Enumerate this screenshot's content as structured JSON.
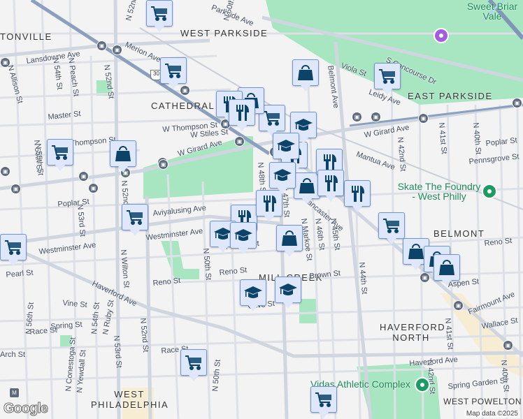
{
  "colors": {
    "marker_fill": "#dfe8fb",
    "marker_border": "#6e95d8",
    "icon": "#0b4468",
    "park": "#a8e6c1",
    "poi_text": "#1e8a5a",
    "monument": "#a35ee0"
  },
  "neighborhoods": [
    "TONVILLE",
    "WEST PARKSIDE",
    "CATHEDRAL PARK",
    "EAST PARKSIDE",
    "BELMONT",
    "MILL CREEK",
    "HAVERFORD NORTH",
    "WEST PHILADELPHIA",
    "WEST POWELTON"
  ],
  "streets": [
    "N 52nd St",
    "N 50th St",
    "Parkside Ave",
    "S Concourse Dr",
    "Merion Ave",
    "Lansdowne Ave",
    "N Allison St",
    "N 54th St",
    "N Peach St",
    "N 52nd St",
    "Master St",
    "W Thompson St",
    "W Stiles St",
    "Thompson St",
    "N 55th St",
    "W Girard Ave",
    "W Girard Ave",
    "Viola St",
    "Leidy Ave",
    "Belmont Ave",
    "Mantua Ave",
    "N 42nd St",
    "N 41st St",
    "N 40th St",
    "Poplar St",
    "Pennsgrove St",
    "Poplar St",
    "N 53rd St",
    "N 52nd St",
    "Aviyalusing Ave",
    "N 48th St",
    "N 47th St",
    "Parrish St",
    "Westminster Ave",
    "Westminster Ave",
    "Lancaster Ave",
    "N Markoe St",
    "N 46th St",
    "N 45th St",
    "N 50th St",
    "Reno St",
    "Reno St",
    "Reno St",
    "Pearl St",
    "Haverford Ave",
    "Vine St",
    "N Wilton St",
    "Brown St",
    "Aspen St",
    "N 44th St",
    "Olive St",
    "Fairmount Ave",
    "N 41st St",
    "Spring St",
    "Race St",
    "N 56th St",
    "N 54th St",
    "N Ruby St",
    "N 53rd St",
    "N 52nd St",
    "Race St",
    "N Conestoga St",
    "N Yewdall St",
    "N 50th St",
    "Haverford Ave",
    "Spring Garden St",
    "N 42nd St",
    "N 40th St",
    "Wallace St",
    "Arch St",
    "N 55th St",
    "Aspen St"
  ],
  "pois": {
    "park_1": "Sweet Briar Vale",
    "skate": "Skate The Foundry - West Philly",
    "vidas": "Vidas Athletic Complex"
  },
  "route_shield": "30",
  "markers": [
    "cart",
    "cart",
    "cart",
    "cart",
    "cart",
    "cart",
    "cart",
    "cart",
    "cart",
    "cart",
    "bag",
    "bag",
    "bag",
    "bag",
    "bag",
    "bag",
    "bag",
    "bag",
    "restaurant",
    "restaurant",
    "restaurant",
    "restaurant",
    "restaurant",
    "restaurant",
    "restaurant",
    "restaurant",
    "school",
    "school",
    "school",
    "school",
    "school",
    "school",
    "school"
  ],
  "attribution": "Map data ©2025",
  "logo": "Google"
}
